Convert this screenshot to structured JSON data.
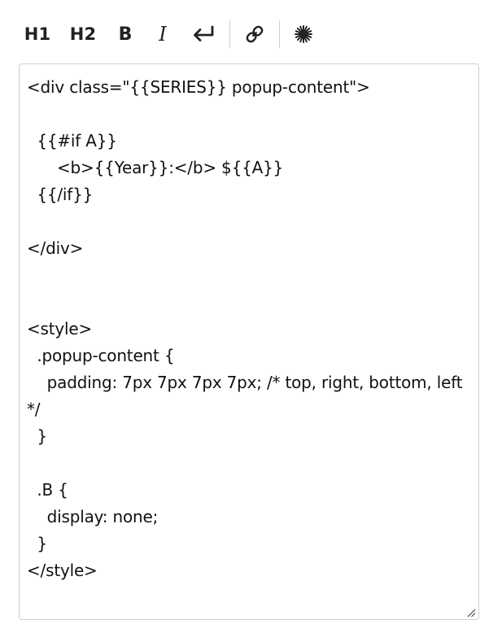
{
  "toolbar": {
    "h1_label": "H1",
    "h2_label": "H2",
    "bold_label": "B",
    "italic_label": "I",
    "icons": {
      "enter": "enter-return-icon",
      "link": "link-icon",
      "special": "sparkle-icon"
    }
  },
  "editor": {
    "content": "<div class=\"{{SERIES}} popup-content\">\n\n  {{#if A}}\n      <b>{{Year}}:</b> ${{A}}\n  {{/if}}\n\n</div>\n\n\n<style>\n  .popup-content {\n    padding: 7px 7px 7px 7px; /* top, right, bottom, left */\n  }\n\n  .B {\n    display: none;\n  }\n</style>"
  }
}
